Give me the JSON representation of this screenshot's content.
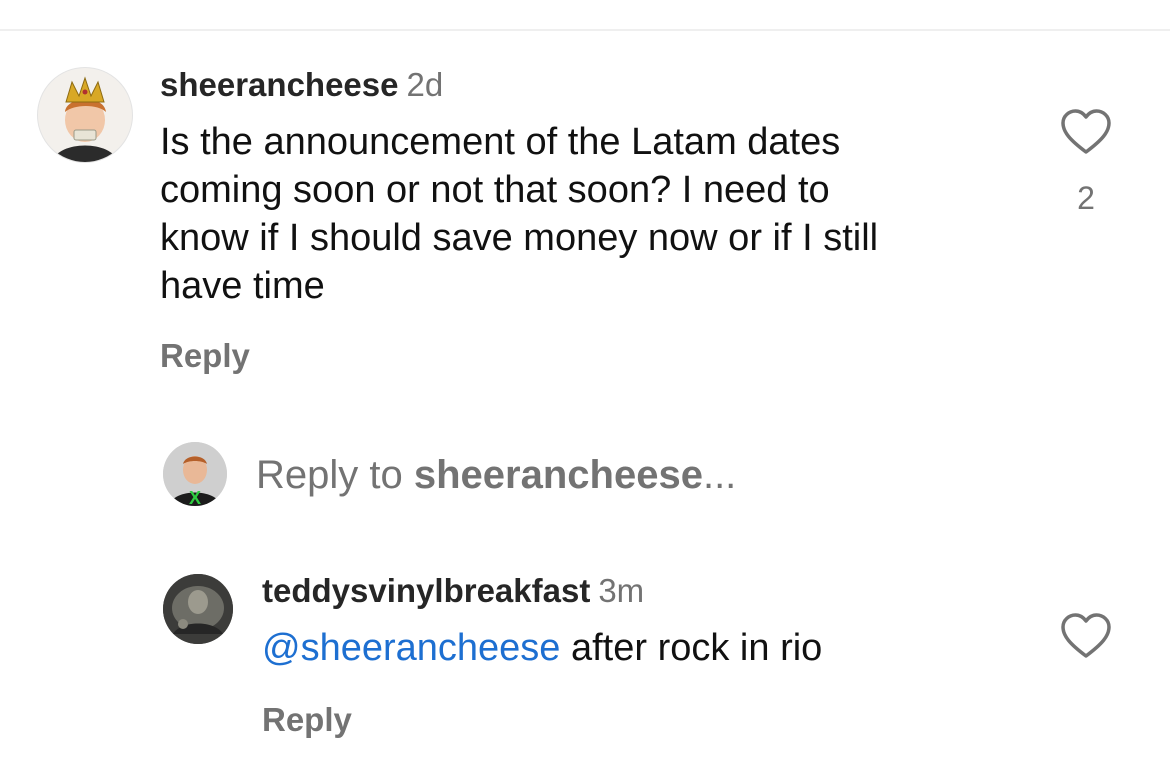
{
  "comments": [
    {
      "username": "sheerancheese",
      "time": "2d",
      "text_lines": [
        "Is the announcement of the Latam dates",
        "coming soon or not that soon? I need to",
        "know if I should save money now or if I still",
        "have time"
      ],
      "reply_label": "Reply",
      "like_count": "2",
      "avatar_icon": "profile-crown-avatar"
    },
    {
      "username": "teddysvinylbreakfast",
      "time": "3m",
      "mention": "@sheerancheese",
      "text": " after rock in rio",
      "reply_label": "Reply",
      "avatar_icon": "profile-dark-avatar"
    }
  ],
  "reply_composer": {
    "prefix": "Reply to ",
    "target": "sheerancheese",
    "suffix": "...",
    "avatar_icon": "current-user-avatar"
  },
  "colors": {
    "text": "#262626",
    "secondary": "#737373",
    "mention": "#1d6fd1",
    "heart_outline": "#737373"
  }
}
